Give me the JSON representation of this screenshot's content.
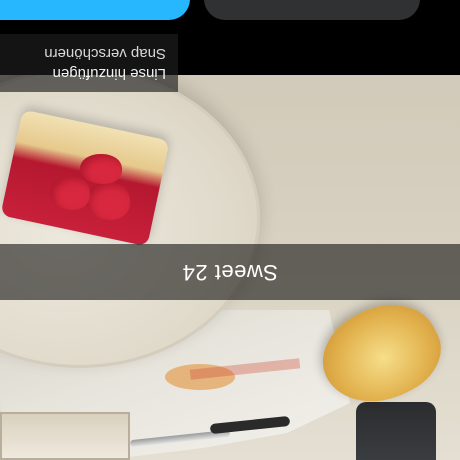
{
  "caption": "Sweet 24",
  "menu": {
    "add_lens": "Linse hinzufügen",
    "enhance_snap": "Snap verschönern"
  },
  "colors": {
    "accent_pill": "#27b7ff",
    "secondary_pill": "#303133",
    "caption_bg": "rgba(0,0,0,0.55)"
  }
}
